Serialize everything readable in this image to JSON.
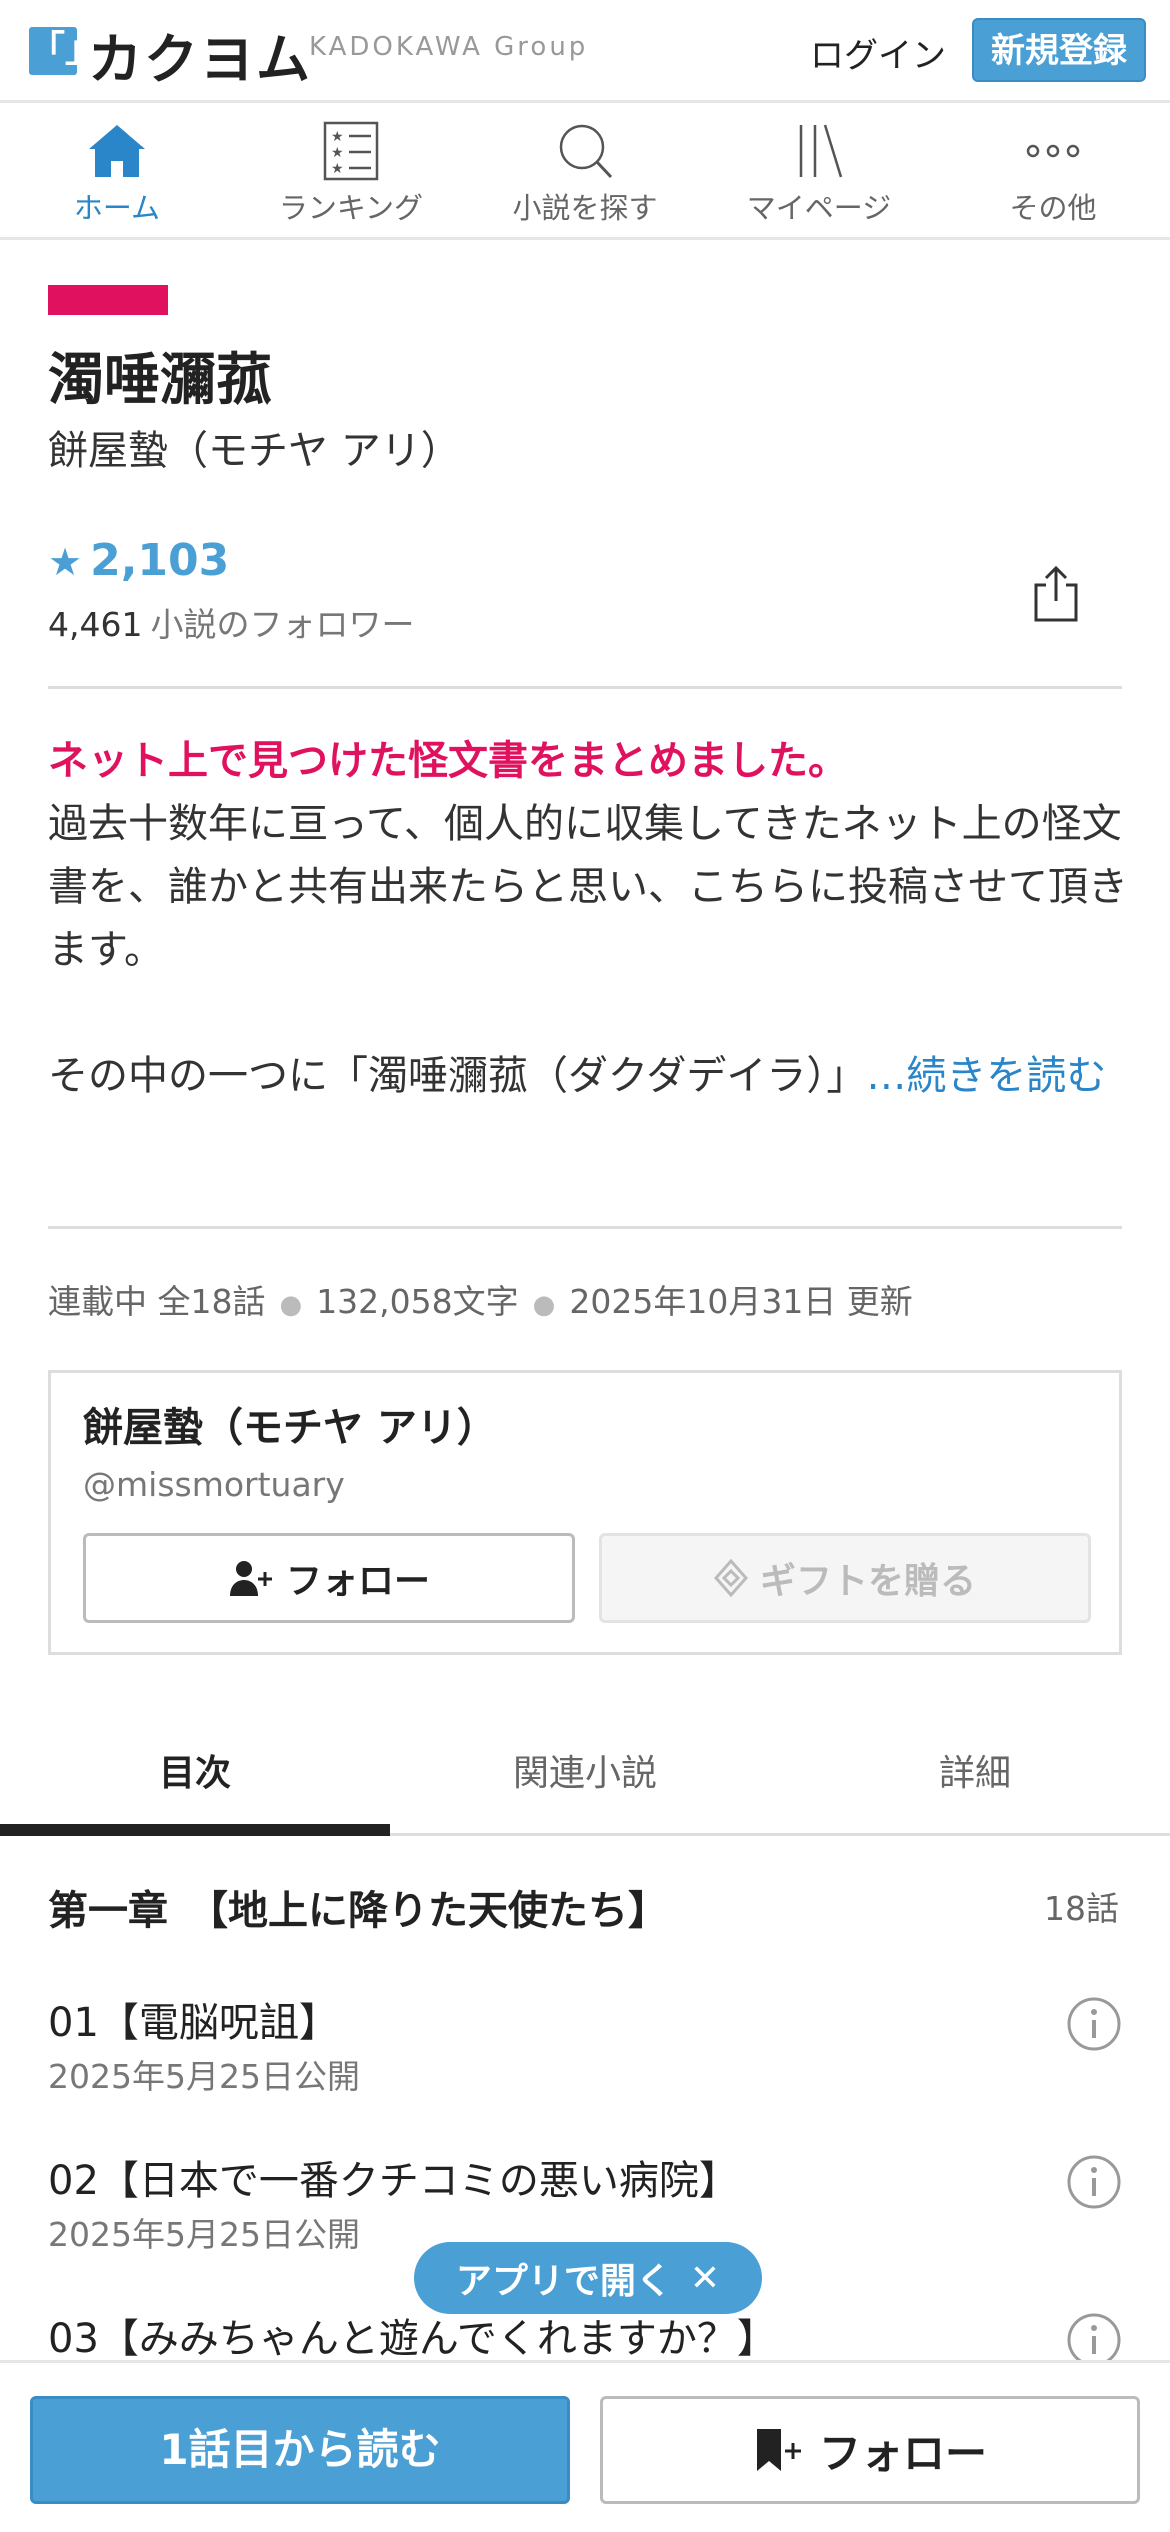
{
  "header": {
    "logo_mark": "「」",
    "logo_text": "カクヨム",
    "logo_group": "KADOKAWA Group",
    "login_label": "ログイン",
    "signup_label": "新規登録"
  },
  "nav": {
    "items": [
      {
        "label": "ホーム",
        "icon": "home-icon",
        "active": true
      },
      {
        "label": "ランキング",
        "icon": "ranking-icon",
        "active": false
      },
      {
        "label": "小説を探す",
        "icon": "search-icon",
        "active": false
      },
      {
        "label": "マイページ",
        "icon": "bookshelf-icon",
        "active": false
      },
      {
        "label": "その他",
        "icon": "more-icon",
        "active": false
      }
    ]
  },
  "work": {
    "title": "濁唾瀰菰",
    "author": "餅屋蟄（モチヤ アリ）",
    "star_symbol": "★",
    "stars": "2,103",
    "followers_count": "4,461",
    "followers_label": "小説のフォロワー",
    "catchphrase": "ネット上で見つけた怪文書をまとめました。",
    "intro_line1": "過去十数年に亘って、個人的に収集してきたネット上の怪文書を、誰かと共有出来たらと思い、こちらに投稿させて頂きます。",
    "intro_line2": "その中の一つに「濁唾瀰菰（ダクダデイラ）」",
    "read_more": "…続きを読む",
    "status": "連載中",
    "episodes": "全18話",
    "chars": "132,058文字",
    "updated": "2025年10月31日 更新",
    "accent_color": "#e0125f"
  },
  "author_card": {
    "name": "餅屋蟄（モチヤ アリ）",
    "handle": "@missmortuary",
    "follow_label": "フォロー",
    "gift_label": "ギフトを贈る"
  },
  "tabs": [
    {
      "label": "目次",
      "active": true
    },
    {
      "label": "関連小説",
      "active": false
    },
    {
      "label": "詳細",
      "active": false
    }
  ],
  "chapter": {
    "title": "第一章　【地上に降りた天使たち】",
    "count": "18話",
    "episodes": [
      {
        "title": "01【電脳呪詛】",
        "date": "2025年5月25日公開"
      },
      {
        "title": "02【日本で一番クチコミの悪い病院】",
        "date": "2025年5月25日公開"
      },
      {
        "title": "03【みみちゃんと遊んでくれますか？】",
        "date": ""
      }
    ]
  },
  "app_bubble": {
    "label": "アプリで開く",
    "close": "✕"
  },
  "bottom_bar": {
    "read_label": "1話目から読む",
    "follow_label": "フォロー"
  },
  "colors": {
    "brand_blue": "#4a9fd5",
    "link_blue": "#2a86c8",
    "accent_pink": "#e0125f"
  }
}
